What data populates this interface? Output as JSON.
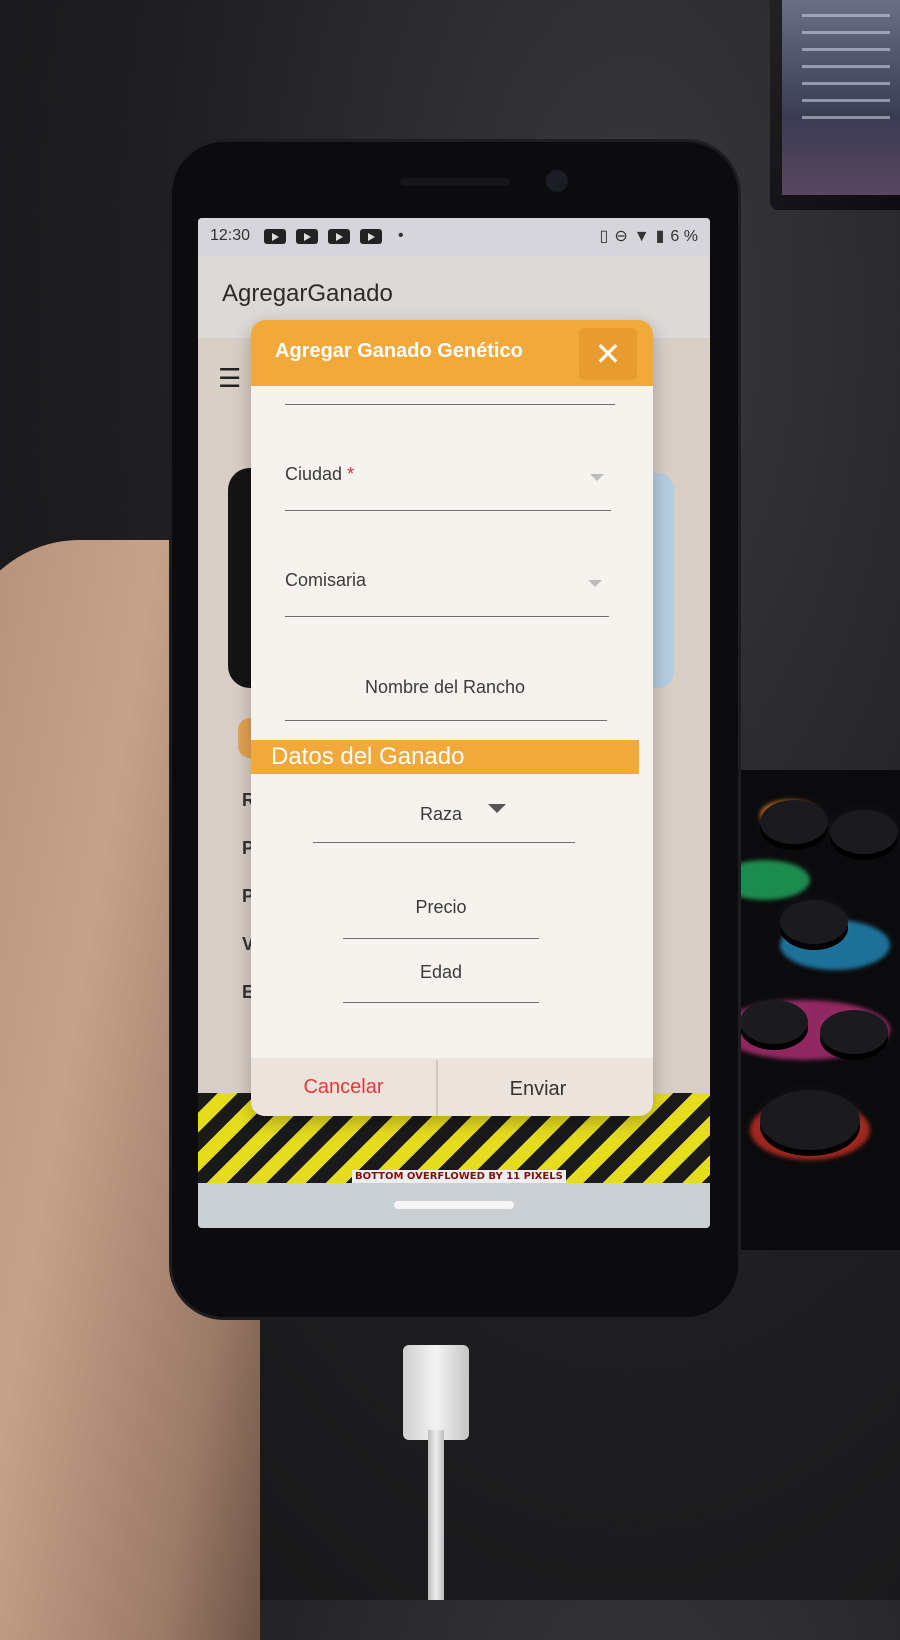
{
  "status_bar": {
    "time": "12:30",
    "battery": "6 %",
    "icons": [
      "youtube-icon",
      "youtube-icon",
      "youtube-icon",
      "youtube-icon",
      "vibrate-icon",
      "dnd-icon",
      "wifi-icon",
      "battery-icon"
    ]
  },
  "app_bar": {
    "title": "AgregarGanado"
  },
  "dialog": {
    "title": "Agregar Ganado Genético",
    "close_glyph": "✕",
    "fields": {
      "ciudad_label": "Ciudad",
      "ciudad_required": "*",
      "comisaria_label": "Comisaria",
      "rancho_label": "Nombre del Rancho",
      "raza_label": "Raza",
      "precio_label": "Precio",
      "edad_label": "Edad"
    },
    "section_title": "Datos del Ganado",
    "cancel_label": "Cancelar",
    "send_label": "Enviar"
  },
  "background_page": {
    "letters": [
      "R",
      "P",
      "P",
      "V",
      "E"
    ]
  },
  "overflow_warning": "BOTTOM OVERFLOWED BY 11 PIXELS",
  "colors": {
    "accent": "#f0a93a",
    "cancel": "#e53935",
    "required": "#d32f2f"
  }
}
